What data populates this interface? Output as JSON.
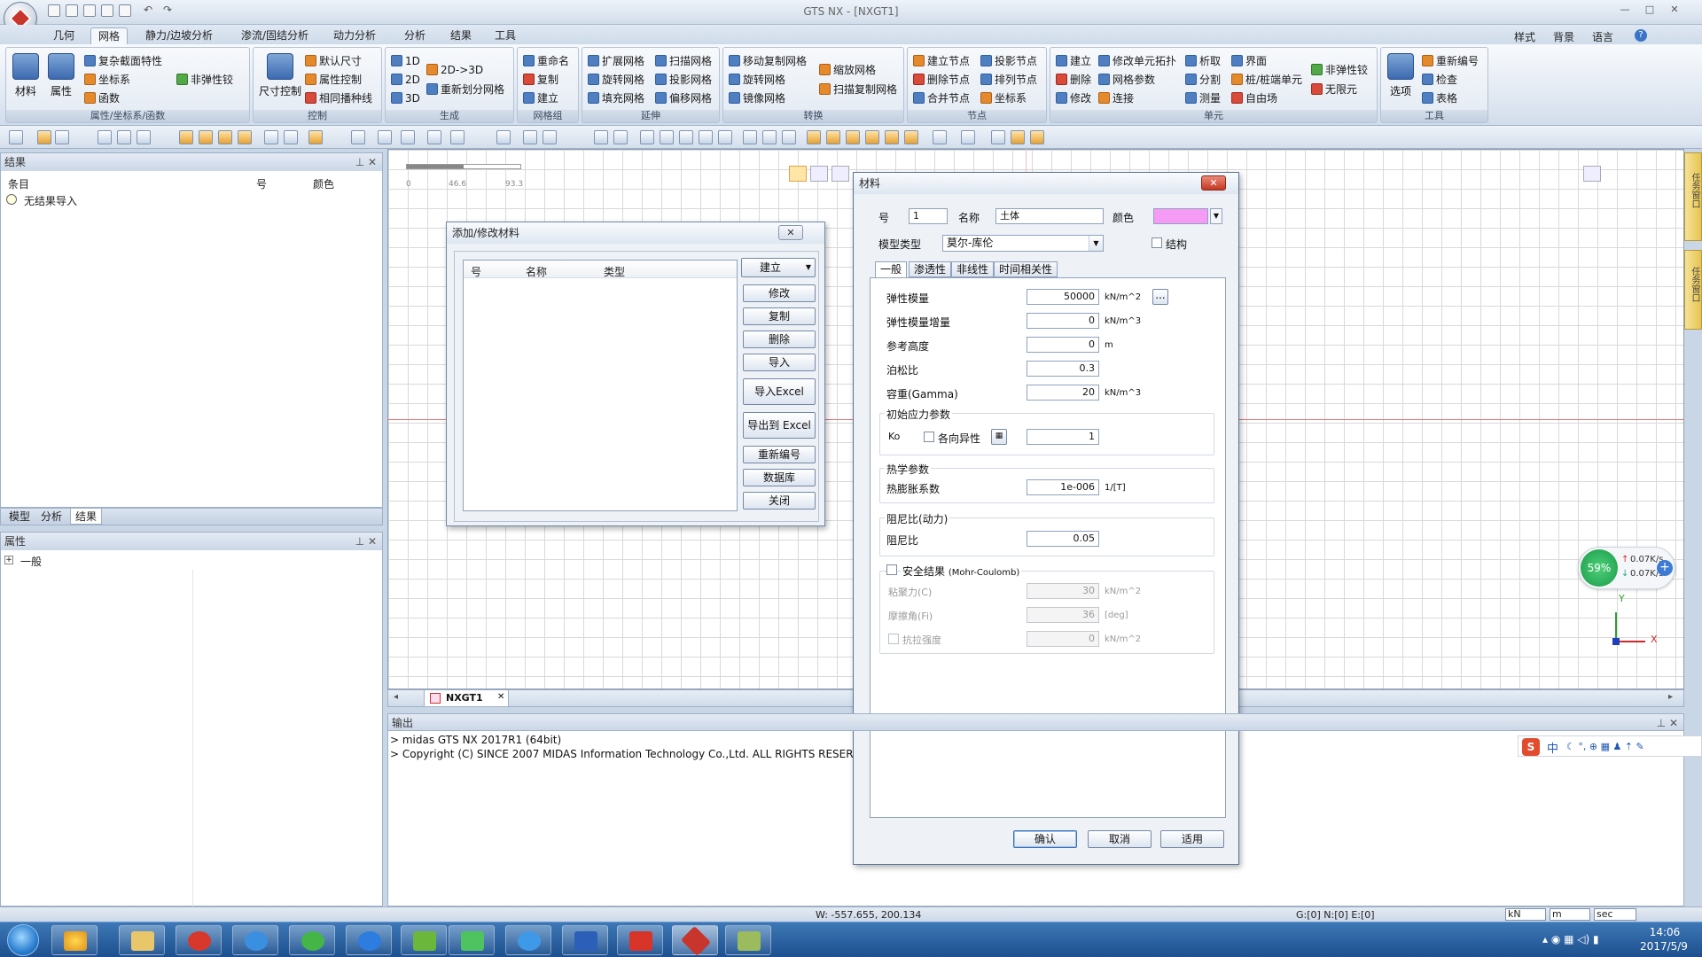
{
  "app": {
    "title": "GTS NX - [NXGT1]"
  },
  "menu": {
    "tabs": [
      "几何",
      "网格",
      "静力/边坡分析",
      "渗流/固结分析",
      "动力分析",
      "分析",
      "结果",
      "工具"
    ],
    "active": "网格",
    "right": [
      "样式",
      "背景",
      "语言"
    ]
  },
  "ribbon": {
    "groups": [
      {
        "caption": "属性/坐标系/函数",
        "items": [
          "材料",
          "属性",
          "复杂截面特性",
          "坐标系",
          "函数",
          "非弹性铰"
        ]
      },
      {
        "caption": "控制",
        "items": [
          "尺寸控制",
          "默认尺寸",
          "属性控制",
          "相同播种线"
        ]
      },
      {
        "caption": "生成",
        "items": [
          "1D",
          "2D",
          "3D",
          "2D->3D",
          "重新划分网格"
        ]
      },
      {
        "caption": "网格组",
        "items": [
          "重命名",
          "复制",
          "建立"
        ]
      },
      {
        "caption": "延伸",
        "items": [
          "扩展网格",
          "旋转网格",
          "填充网格",
          "扫描网格",
          "投影网格",
          "偏移网格"
        ]
      },
      {
        "caption": "转换",
        "items": [
          "移动复制网格",
          "旋转网格",
          "镜像网格",
          "缩放网格",
          "扫描复制网格"
        ]
      },
      {
        "caption": "节点",
        "items": [
          "建立节点",
          "删除节点",
          "合并节点",
          "投影节点",
          "排列节点",
          "坐标系"
        ]
      },
      {
        "caption": "单元",
        "items": [
          "建立",
          "删除",
          "修改",
          "修改单元拓扑",
          "网格参数",
          "连接",
          "析取",
          "分割",
          "测量",
          "界面",
          "桩/桩端单元",
          "自由场",
          "非弹性铰",
          "无限元"
        ]
      },
      {
        "caption": "工具",
        "items": [
          "选项",
          "重新编号",
          "检查",
          "表格"
        ]
      }
    ]
  },
  "results_panel": {
    "title": "结果",
    "col_item": "条目",
    "col_no": "号",
    "col_color": "颜色",
    "empty_item": "无结果导入",
    "tabs": [
      "模型",
      "分析",
      "结果"
    ],
    "active_tab": "结果"
  },
  "properties_panel": {
    "title": "属性",
    "tree_item": "一般"
  },
  "viewport": {
    "scale_ticks": [
      "0",
      "46.6",
      "93.3"
    ],
    "axis_x": "X",
    "axis_y": "Y",
    "doc_tab": "NXGT1",
    "net_percent": "59%",
    "net_up": "0.07K/s",
    "net_down": "0.07K/s",
    "side_tab_1": "任务窗口",
    "side_tab_2": "任务窗口"
  },
  "output": {
    "title": "输出",
    "lines": [
      "> midas GTS NX 2017R1 (64bit)",
      "> Copyright (C) SINCE 2007 MIDAS Information Technology Co.,Ltd. ALL RIGHTS RESERVED."
    ]
  },
  "status": {
    "coords": "W: -557.655, 200.134",
    "counts": "G:[0] N:[0] E:[0]",
    "unit_force": "kN",
    "unit_length": "m",
    "unit_time": "sec"
  },
  "taskbar": {
    "time": "14:06",
    "date": "2017/5/9"
  },
  "ime": {
    "label": "中"
  },
  "add_material_dialog": {
    "title": "添加/修改材料",
    "columns": [
      "号",
      "名称",
      "类型"
    ],
    "buttons": [
      "建立",
      "修改",
      "复制",
      "删除",
      "导入",
      "导入Excel",
      "导出到 Excel",
      "重新编号",
      "数据库",
      "关闭"
    ]
  },
  "material_dialog": {
    "title": "材料",
    "id_label": "号",
    "id_value": "1",
    "name_label": "名称",
    "name_value": "土体",
    "color_label": "颜色",
    "color_value": "#f59af5",
    "model_type_label": "模型类型",
    "model_type_value": "莫尔-库伦",
    "structure_label": "结构",
    "tabs": [
      "一般",
      "渗透性",
      "非线性",
      "时间相关性"
    ],
    "active_tab": "一般",
    "fields": [
      {
        "label": "弹性模量",
        "value": "50000",
        "unit": "kN/m^2"
      },
      {
        "label": "弹性模量增量",
        "value": "0",
        "unit": "kN/m^3"
      },
      {
        "label": "参考高度",
        "value": "0",
        "unit": "m"
      },
      {
        "label": "泊松比",
        "value": "0.3",
        "unit": ""
      },
      {
        "label": "容重(Gamma)",
        "value": "20",
        "unit": "kN/m^3"
      }
    ],
    "initial_stress": {
      "title": "初始应力参数",
      "ko_label": "Ko",
      "aniso_label": "各向异性",
      "ko_value": "1"
    },
    "thermal": {
      "title": "热学参数",
      "label": "热膨胀系数",
      "value": "1e-006",
      "unit": "1/[T]"
    },
    "damping": {
      "title": "阻尼比(动力)",
      "label": "阻尼比",
      "value": "0.05"
    },
    "safety": {
      "title": "安全结果",
      "title_note": "(Mohr-Coulomb)",
      "fields": [
        {
          "label": "粘聚力(C)",
          "value": "30",
          "unit": "kN/m^2"
        },
        {
          "label": "摩擦角(Fi)",
          "value": "36",
          "unit": "[deg]"
        },
        {
          "label": "抗拉强度",
          "value": "0",
          "unit": "kN/m^2"
        }
      ]
    },
    "buttons": {
      "ok": "确认",
      "cancel": "取消",
      "apply": "适用"
    }
  }
}
